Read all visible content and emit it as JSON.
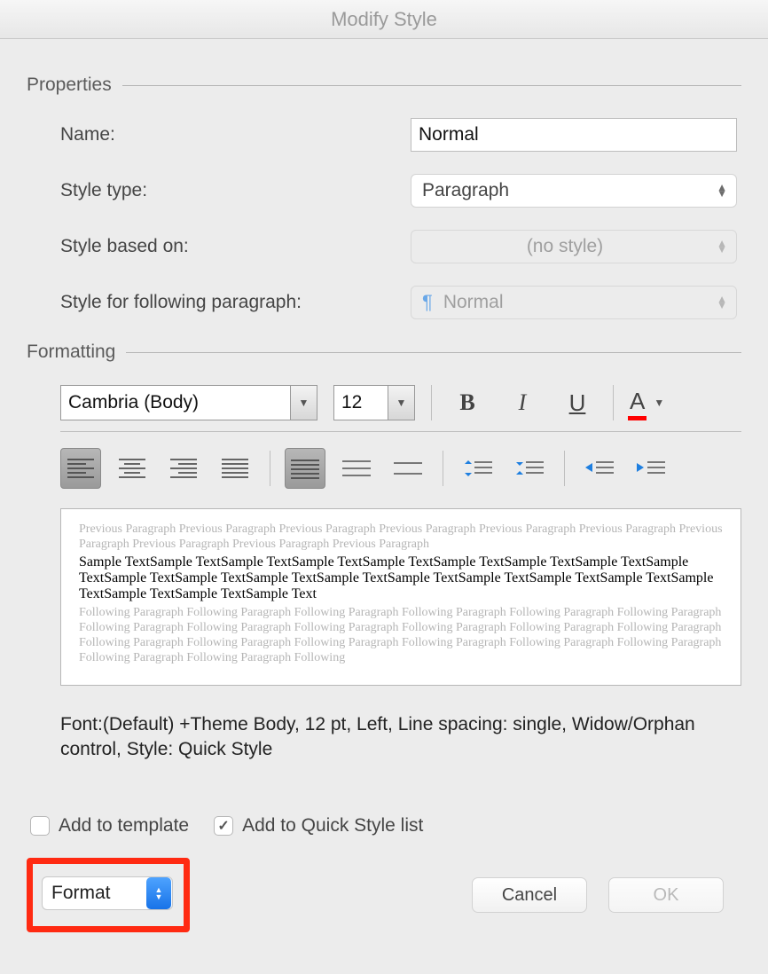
{
  "title": "Modify Style",
  "sections": {
    "properties": "Properties",
    "formatting": "Formatting"
  },
  "labels": {
    "name": "Name:",
    "styleType": "Style type:",
    "basedOn": "Style based on:",
    "following": "Style for following paragraph:"
  },
  "values": {
    "name": "Normal",
    "styleType": "Paragraph",
    "basedOn": "(no style)",
    "following": "Normal"
  },
  "formatting": {
    "font": "Cambria (Body)",
    "size": "12",
    "bold": "B",
    "italic": "I",
    "underline": "U",
    "fontColor": "A"
  },
  "previewGhostPrev": "Previous Paragraph Previous Paragraph Previous Paragraph Previous Paragraph Previous Paragraph Previous Paragraph Previous Paragraph Previous Paragraph Previous Paragraph Previous Paragraph",
  "previewSample": "Sample TextSample TextSample TextSample TextSample TextSample TextSample TextSample TextSample TextSample TextSample TextSample TextSample TextSample TextSample TextSample TextSample TextSample TextSample TextSample TextSample Text",
  "previewGhostNext": "Following Paragraph Following Paragraph Following Paragraph Following Paragraph Following Paragraph Following Paragraph Following Paragraph Following Paragraph Following Paragraph Following Paragraph Following Paragraph Following Paragraph Following Paragraph Following Paragraph Following Paragraph Following Paragraph Following Paragraph Following Paragraph Following Paragraph Following Paragraph Following",
  "description": "Font:(Default) +Theme Body, 12 pt, Left, Line spacing:  single, Widow/Orphan control, Style: Quick Style",
  "checkboxes": {
    "addTemplate": "Add to template",
    "addQuick": "Add to Quick Style list"
  },
  "buttons": {
    "format": "Format",
    "cancel": "Cancel",
    "ok": "OK"
  }
}
